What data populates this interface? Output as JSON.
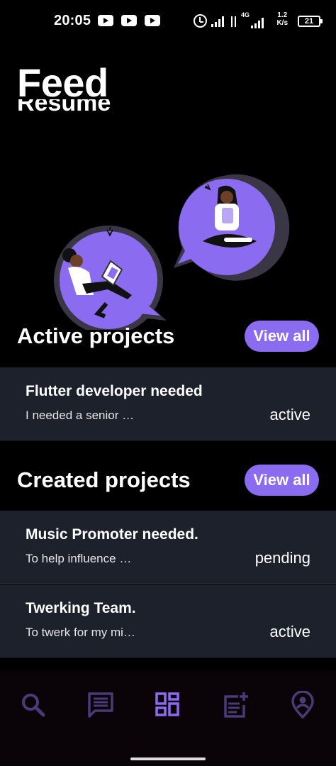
{
  "status_bar": {
    "time": "20:05",
    "network": "4G",
    "speed_value": "1.2",
    "speed_unit": "K/s",
    "battery": "21",
    "icons": [
      "youtube-icon",
      "youtube-icon",
      "youtube-icon",
      "alarm-icon",
      "signal-icon",
      "data-arrows-icon",
      "signal-icon",
      "battery-icon"
    ]
  },
  "header": {
    "title": "Feed",
    "partially_hidden_heading": "Resume"
  },
  "active_projects": {
    "title": "Active projects",
    "view_all_label": "View all",
    "items": [
      {
        "title": "Flutter developer needed",
        "description": "I needed a senior …",
        "status": "active"
      }
    ]
  },
  "created_projects": {
    "title": "Created projects",
    "view_all_label": "View all",
    "items": [
      {
        "title": "Music Promoter needed.",
        "description": "To help influence …",
        "status": "pending"
      },
      {
        "title": "Twerking Team.",
        "description": "To twerk for my mi…",
        "status": "active"
      }
    ]
  },
  "bottom_nav": {
    "items": [
      {
        "icon": "search-icon",
        "active": false
      },
      {
        "icon": "message-icon",
        "active": false
      },
      {
        "icon": "grid-icon",
        "active": true
      },
      {
        "icon": "note-add-icon",
        "active": false
      },
      {
        "icon": "location-person-icon",
        "active": false
      }
    ]
  },
  "colors": {
    "accent": "#8b6cf0",
    "nav_inactive": "#4b3a78",
    "card_bg": "#1c212b",
    "background": "#000000"
  }
}
